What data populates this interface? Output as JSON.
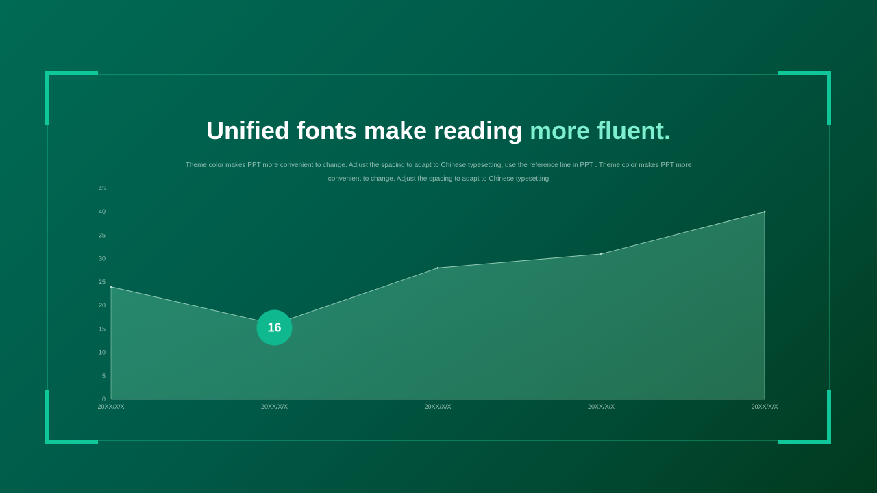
{
  "header": {
    "title_main": "Unified fonts make reading ",
    "title_accent": "more fluent.",
    "subtitle": "Theme color makes PPT more convenient to change. Adjust the spacing to adapt to Chinese typesetting, use the reference line in PPT . Theme color makes PPT more convenient to change. Adjust the spacing to adapt to Chinese typesetting"
  },
  "colors": {
    "accent": "#10c79a",
    "title_accent": "#7ff0cf",
    "callout": "#0fb88e",
    "area_fill": "#4fae8f"
  },
  "chart_data": {
    "type": "area",
    "categories": [
      "20XX/X/X",
      "20XX/X/X",
      "20XX/X/X",
      "20XX/X/X",
      "20XX/X/X"
    ],
    "series": [
      {
        "values": [
          24,
          16,
          28,
          31,
          40
        ]
      }
    ],
    "ylim": [
      0,
      45
    ],
    "yticks": [
      0,
      5,
      10,
      15,
      20,
      25,
      30,
      35,
      40,
      45
    ],
    "grid": false,
    "annotation": {
      "index": 1,
      "text": "16"
    }
  }
}
